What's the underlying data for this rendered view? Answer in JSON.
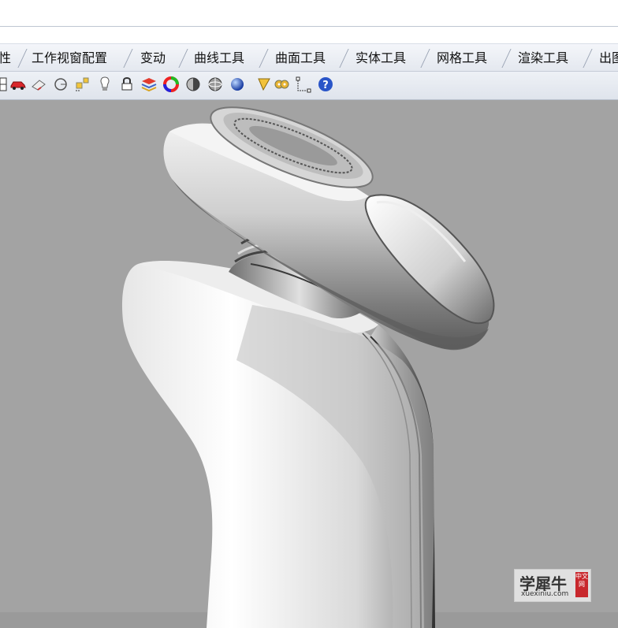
{
  "menu_tabs": [
    {
      "label": "性"
    },
    {
      "label": "工作视窗配置"
    },
    {
      "label": "变动"
    },
    {
      "label": "曲线工具"
    },
    {
      "label": "曲面工具"
    },
    {
      "label": "实体工具"
    },
    {
      "label": "网格工具"
    },
    {
      "label": "渲染工具"
    },
    {
      "label": "出图"
    }
  ],
  "toolbar_icons": [
    "grid-icon",
    "car-icon",
    "eraser-icon",
    "rotate-view-icon",
    "select-objects-icon",
    "light-bulb-icon",
    "lock-icon",
    "layer-icon",
    "color-wheel-icon",
    "shade-sphere-icon",
    "render-sphere-icon",
    "blue-sphere-icon",
    "flag-icon",
    "settings-gear-icon",
    "dimension-icon",
    "help-icon"
  ],
  "watermark": {
    "title": "学犀牛",
    "url": "xuexiniu.com",
    "badge": "中文网"
  },
  "colors": {
    "viewport_bg": "#a3a3a3",
    "tab_bg": "#e8ebf1"
  }
}
